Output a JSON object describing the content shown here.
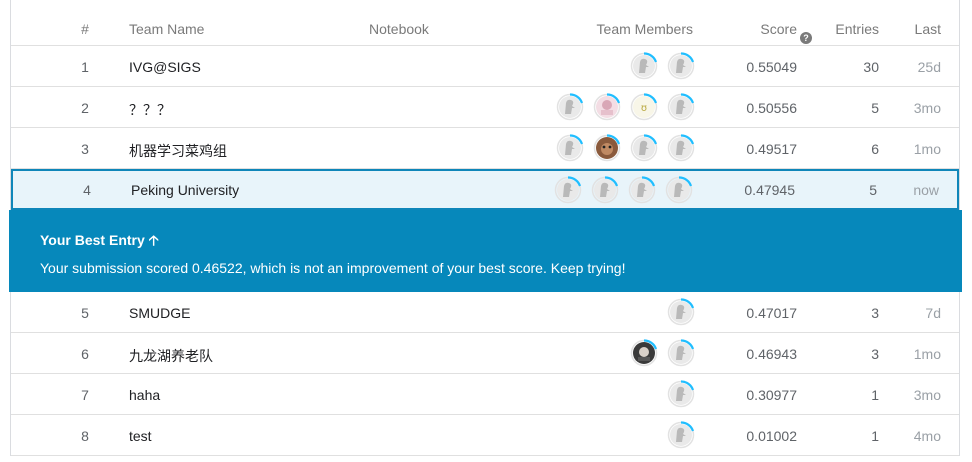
{
  "header": {
    "rank": "#",
    "team_name": "Team Name",
    "notebook": "Notebook",
    "team_members": "Team Members",
    "score": "Score",
    "entries": "Entries",
    "last": "Last"
  },
  "rows": [
    {
      "rank": "1",
      "team": "IVG@SIGS",
      "score": "0.55049",
      "entries": "30",
      "last": "25d",
      "avatars": [
        "goose-avatar",
        "goose-avatar"
      ]
    },
    {
      "rank": "2",
      "team": "？？？",
      "score": "0.50556",
      "entries": "5",
      "last": "3mo",
      "avatars": [
        "goose-avatar",
        "pink-photo-avatar",
        "emoji-avatar",
        "goose-avatar"
      ]
    },
    {
      "rank": "3",
      "team": "机器学习菜鸡组",
      "score": "0.49517",
      "entries": "6",
      "last": "1mo",
      "avatars": [
        "goose-avatar",
        "dog-photo-avatar",
        "goose-avatar",
        "goose-avatar"
      ]
    },
    {
      "rank": "4",
      "team": "Peking University",
      "score": "0.47945",
      "entries": "5",
      "last": "now",
      "avatars": [
        "goose-avatar",
        "goose-avatar",
        "goose-avatar",
        "goose-avatar"
      ]
    },
    {
      "rank": "5",
      "team": "SMUDGE",
      "score": "0.47017",
      "entries": "3",
      "last": "7d",
      "avatars": [
        "goose-avatar"
      ]
    },
    {
      "rank": "6",
      "team": "九龙湖养老队",
      "score": "0.46943",
      "entries": "3",
      "last": "1mo",
      "avatars": [
        "person-photo-avatar",
        "goose-avatar"
      ]
    },
    {
      "rank": "7",
      "team": "haha",
      "score": "0.30977",
      "entries": "1",
      "last": "3mo",
      "avatars": [
        "goose-avatar"
      ]
    },
    {
      "rank": "8",
      "team": "test",
      "score": "0.01002",
      "entries": "1",
      "last": "4mo",
      "avatars": [
        "goose-avatar"
      ]
    }
  ],
  "banner": {
    "title": "Your Best Entry",
    "arrow_icon": "arrow-up-icon",
    "message": "Your submission scored 0.46522, which is not an improvement of your best score. Keep trying!"
  },
  "colors": {
    "banner": "#0688bb",
    "highlight_row": "#e8f4fa",
    "progress_ring": "#20beff"
  }
}
